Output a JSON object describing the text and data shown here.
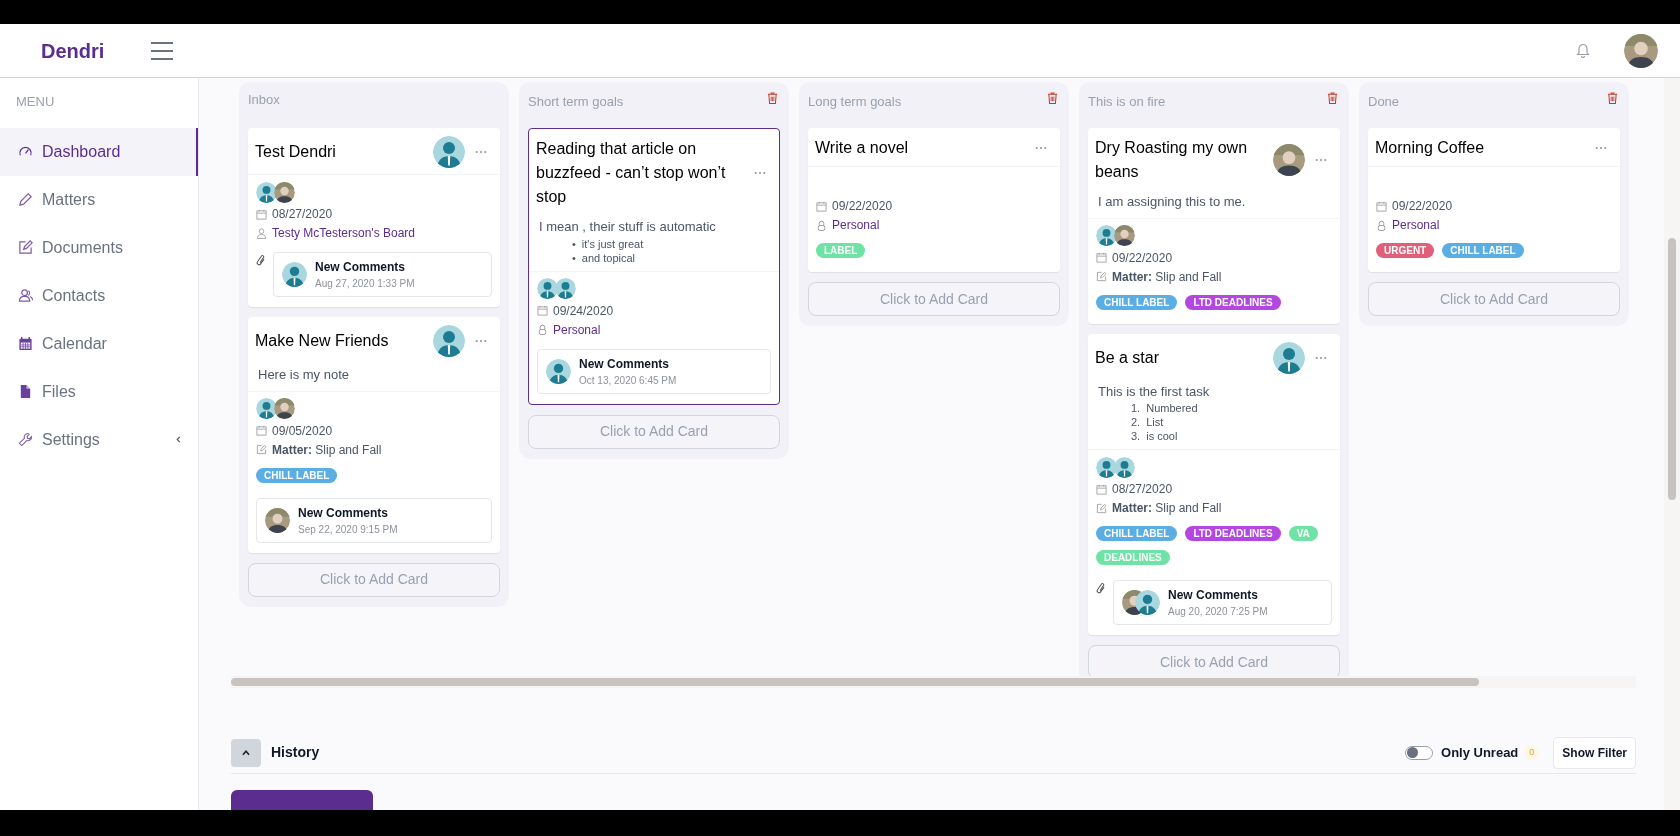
{
  "header": {
    "logo": "Dendri",
    "user_avatar": {
      "kind": "photo"
    }
  },
  "sidebar": {
    "heading": "MENU",
    "items": [
      {
        "label": "Dashboard",
        "selected": true,
        "kind": "link"
      },
      {
        "label": "Matters",
        "selected": false,
        "kind": "link"
      },
      {
        "label": "Documents",
        "selected": false,
        "kind": "link"
      },
      {
        "label": "Contacts",
        "selected": false,
        "kind": "link"
      },
      {
        "label": "Calendar",
        "selected": false,
        "kind": "link"
      },
      {
        "label": "Files",
        "selected": false,
        "kind": "link"
      },
      {
        "label": "Settings",
        "selected": false,
        "kind": "group"
      }
    ]
  },
  "columns": [
    {
      "title": "Inbox",
      "deletable": false,
      "add_button": "Click to Add Card",
      "cards": [
        {
          "title": "Test Dendri",
          "selected": false,
          "assignee": {
            "kind": "generic"
          },
          "members": [
            {
              "kind": "generic"
            },
            {
              "kind": "photo"
            }
          ],
          "details": [
            {
              "kind": "date",
              "text": "08/27/2020"
            },
            {
              "kind": "board",
              "text": "Testy McTesterson's Board"
            }
          ],
          "comment": {
            "title": "New Comments",
            "time": "Aug 27, 2020 1:33 PM",
            "avatars": [
              {
                "kind": "generic"
              }
            ],
            "attachment": true
          }
        },
        {
          "title": "Make New Friends",
          "selected": false,
          "assignee": {
            "kind": "generic"
          },
          "note": "Here is my note",
          "members": [
            {
              "kind": "generic"
            },
            {
              "kind": "photo"
            }
          ],
          "details": [
            {
              "kind": "date",
              "text": "09/05/2020"
            },
            {
              "kind": "matter",
              "text": "**Matter:** Slip and Fall"
            }
          ],
          "labels": [
            {
              "text": "CHILL LABEL",
              "color": "#5aaee3"
            }
          ],
          "comment": {
            "title": "New Comments",
            "time": "Sep 22, 2020 9:15 PM",
            "avatars": [
              {
                "kind": "photo"
              }
            ],
            "attachment": false
          }
        }
      ]
    },
    {
      "title": "Short term goals",
      "deletable": true,
      "add_button": "Click to Add Card",
      "cards": [
        {
          "title": "Reading that article on buzzfeed - can’t stop won’t stop",
          "selected": true,
          "note": "I mean , their stuff is automatic",
          "note_list": [
            {
              "marker": "•",
              "text": "it's just great"
            },
            {
              "marker": "•",
              "text": "and topical"
            }
          ],
          "members": [
            {
              "kind": "generic"
            },
            {
              "kind": "generic"
            }
          ],
          "details": [
            {
              "kind": "date",
              "text": "09/24/2020"
            },
            {
              "kind": "personal",
              "text": "Personal"
            }
          ],
          "comment": {
            "title": "New Comments",
            "time": "Oct 13, 2020 6:45 PM",
            "avatars": [
              {
                "kind": "generic"
              }
            ],
            "attachment": false
          }
        }
      ]
    },
    {
      "title": "Long term goals",
      "deletable": true,
      "add_button": "Click to Add Card",
      "cards": [
        {
          "title": "Write a novel",
          "selected": false,
          "details": [
            {
              "kind": "date",
              "text": "09/22/2020"
            },
            {
              "kind": "personal",
              "text": "Personal"
            }
          ],
          "labels": [
            {
              "text": "LABEL",
              "color": "#6ee3a5"
            }
          ]
        }
      ]
    },
    {
      "title": "This is on fire",
      "deletable": true,
      "add_button": "Click to Add Card",
      "cards": [
        {
          "title": "Dry Roasting my own beans",
          "selected": false,
          "assignee": {
            "kind": "photo"
          },
          "note": "I am assigning this to me.",
          "members": [
            {
              "kind": "generic"
            },
            {
              "kind": "photo"
            }
          ],
          "details": [
            {
              "kind": "date",
              "text": "09/22/2020"
            },
            {
              "kind": "matter",
              "text": "**Matter:** Slip and Fall"
            }
          ],
          "labels": [
            {
              "text": "CHILL LABEL",
              "color": "#5aaee3"
            },
            {
              "text": "LTD DEADLINES",
              "color": "#b347e0"
            }
          ]
        },
        {
          "title": "Be a star",
          "selected": false,
          "assignee": {
            "kind": "generic"
          },
          "note": "This is the first task",
          "note_list": [
            {
              "marker": "1.",
              "text": "Numbered"
            },
            {
              "marker": "2.",
              "text": "List"
            },
            {
              "marker": "3.",
              "text": "is cool"
            }
          ],
          "members": [
            {
              "kind": "generic"
            },
            {
              "kind": "generic"
            }
          ],
          "details": [
            {
              "kind": "date",
              "text": "08/27/2020"
            },
            {
              "kind": "matter",
              "text": "**Matter:** Slip and Fall"
            }
          ],
          "labels": [
            {
              "text": "CHILL LABEL",
              "color": "#5aaee3"
            },
            {
              "text": "LTD DEADLINES",
              "color": "#b347e0"
            },
            {
              "text": "VA DEADLINES",
              "color": "#6ee3a5"
            }
          ],
          "comment": {
            "title": "New Comments",
            "time": "Aug 20, 2020 7:25 PM",
            "avatars": [
              {
                "kind": "photo"
              },
              {
                "kind": "generic"
              }
            ],
            "attachment": true
          }
        }
      ]
    },
    {
      "title": "Done",
      "deletable": true,
      "add_button": "Click to Add Card",
      "cards": [
        {
          "title": "Morning Coffee",
          "selected": false,
          "details": [
            {
              "kind": "date",
              "text": "09/22/2020"
            },
            {
              "kind": "personal",
              "text": "Personal"
            }
          ],
          "labels": [
            {
              "text": "URGENT",
              "color": "#e0607a"
            },
            {
              "text": "CHILL LABEL",
              "color": "#5aaee3"
            }
          ]
        }
      ]
    }
  ],
  "history": {
    "title": "History",
    "expanded": true,
    "filter_toggle": {
      "label": "Only Unread",
      "on": false,
      "count": "0"
    },
    "filter_button": "Show Filter"
  }
}
